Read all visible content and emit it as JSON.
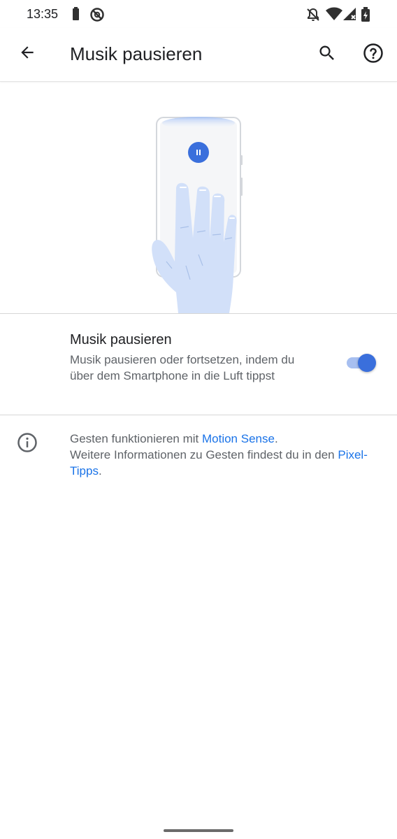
{
  "status_bar": {
    "time": "13:35",
    "icons": [
      "battery-saver-icon",
      "do-not-disturb-icon",
      "notifications-off-icon",
      "wifi-icon",
      "signal-icon",
      "battery-charging-icon"
    ]
  },
  "app_bar": {
    "title": "Musik pausieren",
    "back_icon": "arrow-back-icon",
    "search_icon": "search-icon",
    "help_icon": "help-icon"
  },
  "setting": {
    "title": "Musik pausieren",
    "summary": "Musik pausieren oder fortsetzen, indem du über dem Smartphone in die Luft tippst",
    "toggle_on": true
  },
  "footer": {
    "line1_prefix": "Gesten funktionieren mit ",
    "link1": "Motion Sense",
    "line1_suffix": ".",
    "line2": "Weitere Informationen zu Gesten findest du in den ",
    "link2": "Pixel-Tipps",
    "line2_suffix": "."
  },
  "colors": {
    "accent": "#3a6fdc",
    "link": "#1a73e8",
    "toggle_track": "#a7bff0",
    "hand": "#d2e0f9"
  }
}
